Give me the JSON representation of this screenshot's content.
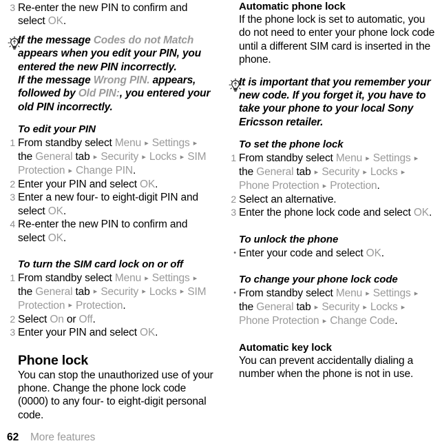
{
  "page": {
    "number": "62",
    "section": "More features"
  },
  "icons": {
    "tip": "lightbulb-icon",
    "separator": "▸"
  },
  "colors": {
    "text": "#000000",
    "ui_reference": "#9a9a9a",
    "marker": "#8e8e8e"
  },
  "left_column": {
    "continued_step": {
      "number": "3",
      "part1": "Re-enter the new PIN to confirm and select ",
      "ui1": "OK",
      "part2": "."
    },
    "tip": {
      "line1_a": "If the message ",
      "line1_ui": "Codes do not Match",
      "line1_b": " appears when you edit your PIN, you entered the new PIN incorrectly.",
      "line2_a": "If the message ",
      "line2_ui": "Wrong PIN.",
      "line2_b": " appears, followed by ",
      "line2_ui2": "Old PIN:",
      "line2_c": ", you entered your old PIN incorrectly."
    },
    "proc_edit_pin": {
      "heading": "To edit your PIN",
      "steps": [
        {
          "number": "1",
          "lead": "From standby select ",
          "path": [
            "Menu",
            "Settings",
            "the|General|tab",
            "Security",
            "Locks",
            "SIM Protection",
            "Change PIN"
          ],
          "tail": "."
        },
        {
          "number": "2",
          "lead": "Enter your PIN and select ",
          "ui": "OK",
          "tail": "."
        },
        {
          "number": "3",
          "lead": "Enter a new four- to eight-digit PIN and select ",
          "ui": "OK",
          "tail": "."
        },
        {
          "number": "4",
          "lead": "Re-enter the new PIN to confirm and select ",
          "ui": "OK",
          "tail": "."
        }
      ]
    },
    "proc_sim_lock": {
      "heading": "To turn the SIM card lock on or off",
      "steps": [
        {
          "number": "1",
          "lead": "From standby select ",
          "path": [
            "Menu",
            "Settings",
            "the|General|tab",
            "Security",
            "Locks",
            "SIM Protection",
            "Protection"
          ],
          "tail": "."
        },
        {
          "number": "2",
          "lead": "Select ",
          "ui": "On",
          "mid": " or ",
          "ui2": "Off",
          "tail": "."
        },
        {
          "number": "3",
          "lead": "Enter your PIN and select ",
          "ui": "OK",
          "tail": "."
        }
      ]
    },
    "phone_lock": {
      "heading": "Phone lock",
      "body": "You can stop the unauthorized use of your phone. Change the phone lock code (0000) to any four- to eight-digit personal code."
    }
  },
  "right_column": {
    "automatic_phone_lock": {
      "heading": "Automatic phone lock",
      "body": "If the phone lock is set to automatic, you do not need to enter your phone lock code until a different SIM card is inserted in the phone."
    },
    "tip": {
      "text": "It is important that you remember your new code. If you forget it, you have to take your phone to your local Sony Ericsson retailer."
    },
    "proc_set_phone_lock": {
      "heading": "To set the phone lock",
      "steps": [
        {
          "number": "1",
          "lead": "From standby select ",
          "path": [
            "Menu",
            "Settings",
            "the|General|tab",
            "Security",
            "Locks",
            "Phone Protection",
            "Protection"
          ],
          "tail": "."
        },
        {
          "number": "2",
          "lead": "Select an alternative."
        },
        {
          "number": "3",
          "lead": "Enter the phone lock code and select ",
          "ui": "OK",
          "tail": "."
        }
      ]
    },
    "proc_unlock_phone": {
      "heading": "To unlock the phone",
      "steps": [
        {
          "marker": "•",
          "lead": "Enter your code and select ",
          "ui": "OK",
          "tail": "."
        }
      ]
    },
    "proc_change_code": {
      "heading": "To change your phone lock code",
      "steps": [
        {
          "marker": "•",
          "lead": "From standby select ",
          "path": [
            "Menu",
            "Settings",
            "the|General|tab",
            "Security",
            "Locks",
            "Phone Protection",
            "Change Code"
          ],
          "tail": "."
        }
      ]
    },
    "automatic_key_lock": {
      "heading": "Automatic key lock",
      "body": "You can prevent accidentally dialing a number when the phone is not in use."
    }
  }
}
